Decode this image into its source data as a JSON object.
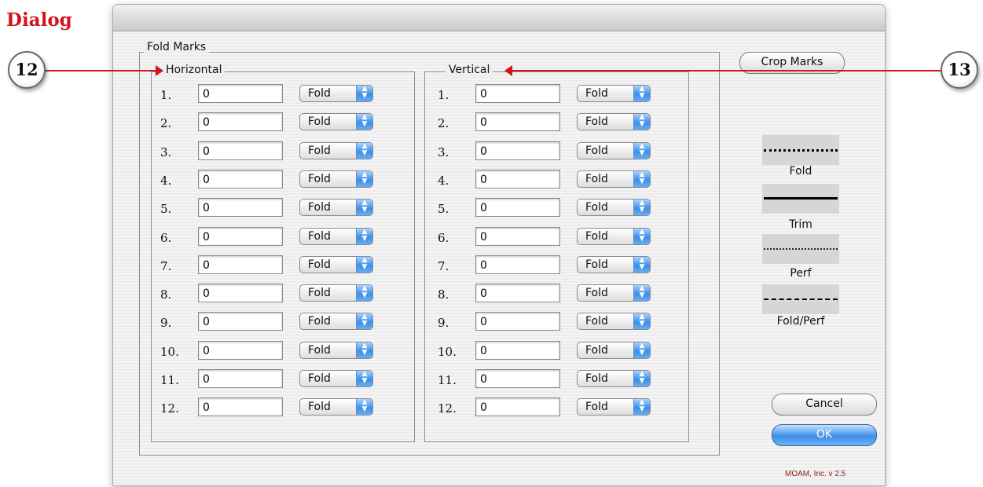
{
  "heading": "Dialog",
  "fold_marks_label": "Fold Marks",
  "horizontal": {
    "label": "Horizontal",
    "rows": [
      {
        "num": "1.",
        "value": "0",
        "type": "Fold"
      },
      {
        "num": "2.",
        "value": "0",
        "type": "Fold"
      },
      {
        "num": "3.",
        "value": "0",
        "type": "Fold"
      },
      {
        "num": "4.",
        "value": "0",
        "type": "Fold"
      },
      {
        "num": "5.",
        "value": "0",
        "type": "Fold"
      },
      {
        "num": "6.",
        "value": "0",
        "type": "Fold"
      },
      {
        "num": "7.",
        "value": "0",
        "type": "Fold"
      },
      {
        "num": "8.",
        "value": "0",
        "type": "Fold"
      },
      {
        "num": "9.",
        "value": "0",
        "type": "Fold"
      },
      {
        "num": "10.",
        "value": "0",
        "type": "Fold"
      },
      {
        "num": "11.",
        "value": "0",
        "type": "Fold"
      },
      {
        "num": "12.",
        "value": "0",
        "type": "Fold"
      }
    ]
  },
  "vertical": {
    "label": "Vertical",
    "rows": [
      {
        "num": "1.",
        "value": "0",
        "type": "Fold"
      },
      {
        "num": "2.",
        "value": "0",
        "type": "Fold"
      },
      {
        "num": "3.",
        "value": "0",
        "type": "Fold"
      },
      {
        "num": "4.",
        "value": "0",
        "type": "Fold"
      },
      {
        "num": "5.",
        "value": "0",
        "type": "Fold"
      },
      {
        "num": "6.",
        "value": "0",
        "type": "Fold"
      },
      {
        "num": "7.",
        "value": "0",
        "type": "Fold"
      },
      {
        "num": "8.",
        "value": "0",
        "type": "Fold"
      },
      {
        "num": "9.",
        "value": "0",
        "type": "Fold"
      },
      {
        "num": "10.",
        "value": "0",
        "type": "Fold"
      },
      {
        "num": "11.",
        "value": "0",
        "type": "Fold"
      },
      {
        "num": "12.",
        "value": "0",
        "type": "Fold"
      }
    ]
  },
  "buttons": {
    "crop_marks": "Crop Marks",
    "cancel": "Cancel",
    "ok": "OK"
  },
  "line_styles": [
    {
      "label": "Fold"
    },
    {
      "label": "Trim"
    },
    {
      "label": "Perf"
    },
    {
      "label": "Fold/Perf"
    }
  ],
  "version": "MOAM, Inc. v 2.5",
  "callouts": {
    "left": "12",
    "right": "13"
  },
  "colors": {
    "callout_red": "#d2151c",
    "ok_blue": "#3d8fe8",
    "select_arrow_blue": "#3c8fe6"
  }
}
